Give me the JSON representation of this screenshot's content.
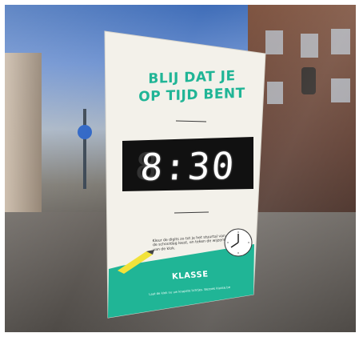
{
  "poster": {
    "headline_line1": "BLIJ DAT JE",
    "headline_line2": "OP TIJD BENT",
    "clock_display": "8:30",
    "tip_text": "Kleur de digits zo tot je het stuurtal van de schooldag leest, en teken de wijzers van de klok.",
    "brand": "KLASSE",
    "footer_text": "Laat de klok nu uw knapste lichtjes. Bezoek klasse.be",
    "accent_color": "#20b596",
    "poster_color": "#f3f1ea",
    "display_color": "#111111"
  }
}
